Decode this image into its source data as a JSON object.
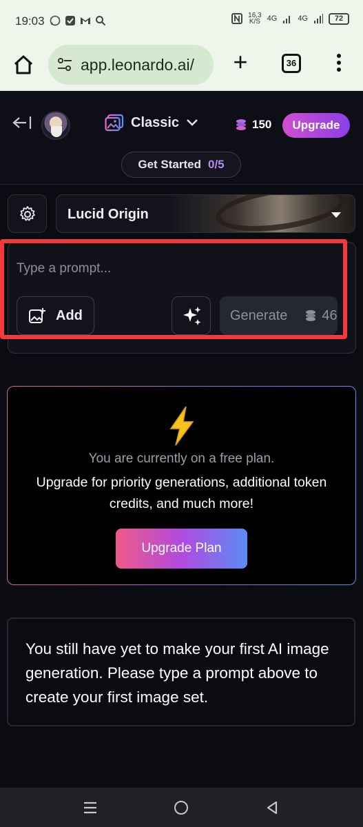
{
  "status_bar": {
    "time": "19:03",
    "speed_top": "16,3",
    "speed_bottom": "K/S",
    "net1": "4G",
    "net2": "4G",
    "battery": "72"
  },
  "browser": {
    "url": "app.leonardo.ai/",
    "tab_count": "36"
  },
  "header": {
    "mode_label": "Classic",
    "tokens": "150",
    "upgrade_label": "Upgrade",
    "get_started_label": "Get Started",
    "get_started_progress": "0/5"
  },
  "model": {
    "selected": "Lucid Origin"
  },
  "prompt": {
    "placeholder": "Type a prompt...",
    "add_label": "Add",
    "generate_label": "Generate",
    "generate_cost": "46"
  },
  "plan_card": {
    "line1": "You are currently on a free plan.",
    "line2": "Upgrade for priority generations, additional token credits, and much more!",
    "button": "Upgrade Plan"
  },
  "info_card": {
    "text": "You still have yet to make your first AI image generation. Please type a prompt above to create your first image set."
  },
  "colors": {
    "highlight": "#f23a3c",
    "upgrade_gradient_start": "#d04fd0",
    "upgrade_gradient_end": "#8a3fe6",
    "progress_accent": "#b38cf0"
  }
}
